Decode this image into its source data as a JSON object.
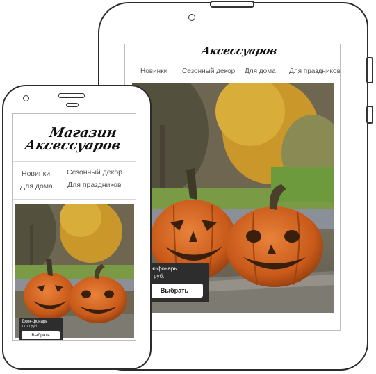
{
  "store": {
    "logo_line1": "Магазин",
    "logo_line2": "Аксессуаров",
    "logo_full": "Аксессуаров"
  },
  "nav": {
    "new": "Новинки",
    "seasonal": "Сезонный декор",
    "home": "Для дома",
    "holidays": "Для праздников"
  },
  "product": {
    "name": "Джек-фонарь",
    "price_tablet": "1100 руб.",
    "price_phone": "1100 руб.",
    "button": "Выбрать"
  },
  "tablet_crop": {
    "name": "жек-фонарь",
    "price": "00 руб."
  },
  "colors": {
    "pumpkin": "#d9661f",
    "pumpkin_dark": "#a8430f",
    "stem": "#3d3a2a",
    "foliage": "#d7a52a",
    "grass": "#6c8f3a",
    "card_bg": "#2d2d2d"
  }
}
